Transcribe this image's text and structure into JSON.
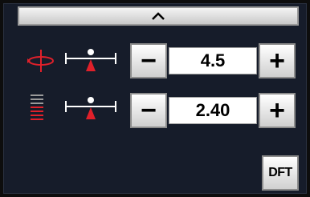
{
  "panel": {
    "collapse_icon": "chevron-up-icon",
    "rows": [
      {
        "icon": "rotation-icon",
        "slider_icon": "balance-slider-icon",
        "minus_label": "−",
        "value": "4.5",
        "plus_label": "+"
      },
      {
        "icon": "line-stack-icon",
        "slider_icon": "balance-slider-icon",
        "minus_label": "−",
        "value": "2.40",
        "plus_label": "+"
      }
    ],
    "dft_label": "DFT"
  },
  "colors": {
    "accent_red": "#e0202a",
    "panel_bg": "#161c2a"
  }
}
